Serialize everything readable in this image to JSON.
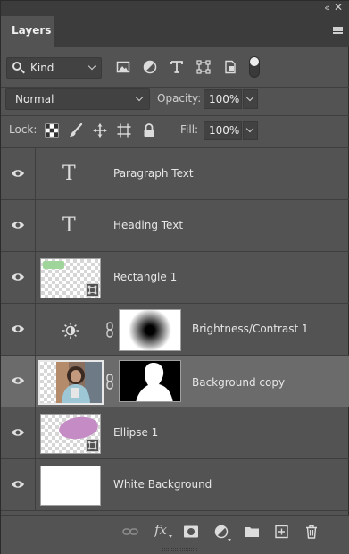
{
  "panel": {
    "tab_label": "Layers"
  },
  "filter": {
    "kind_label": "Kind",
    "icons": [
      "image-filter-icon",
      "adjustment-filter-icon",
      "type-filter-icon",
      "shape-filter-icon",
      "smart-object-filter-icon"
    ]
  },
  "blend": {
    "mode": "Normal",
    "opacity_label": "Opacity:",
    "opacity_value": "100%"
  },
  "lock": {
    "label": "Lock:",
    "fill_label": "Fill:",
    "fill_value": "100%"
  },
  "layers": [
    {
      "name": "Paragraph Text",
      "type": "text",
      "visible": true
    },
    {
      "name": "Heading Text",
      "type": "text",
      "visible": true
    },
    {
      "name": "Rectangle 1",
      "type": "shape",
      "visible": true,
      "color": "#9fd49a"
    },
    {
      "name": "Brightness/Contrast 1",
      "type": "adjustment",
      "visible": true
    },
    {
      "name": "Background copy",
      "type": "image-with-mask",
      "visible": true,
      "selected": true
    },
    {
      "name": "Ellipse 1",
      "type": "shape",
      "visible": true,
      "color": "#c48bc4"
    },
    {
      "name": "White Background",
      "type": "fill",
      "visible": true
    }
  ],
  "footer": {
    "icons": [
      "link-layers-icon",
      "fx-icon",
      "add-mask-icon",
      "adjustment-layer-icon",
      "group-folder-icon",
      "new-layer-icon",
      "delete-icon"
    ],
    "fx_label": "fx"
  },
  "colors": {
    "panel_bg": "#535353",
    "selected_row": "#6b6b6b"
  }
}
